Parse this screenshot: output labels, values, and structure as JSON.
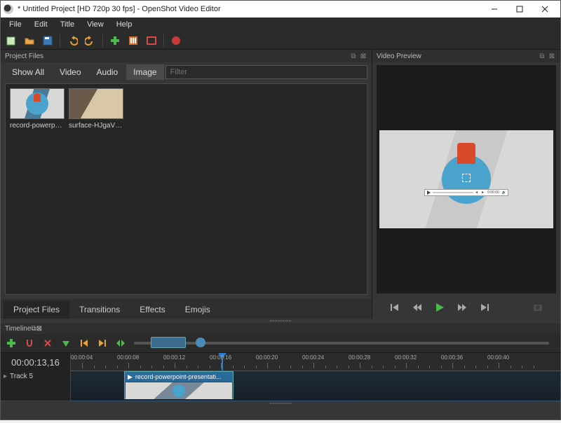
{
  "window": {
    "title": "* Untitled Project [HD 720p 30 fps] - OpenShot Video Editor"
  },
  "menubar": [
    "File",
    "Edit",
    "Title",
    "View",
    "Help"
  ],
  "panes": {
    "project_files": "Project Files",
    "video_preview": "Video Preview",
    "timeline": "Timeline"
  },
  "filter_tabs": [
    "Show All",
    "Video",
    "Audio",
    "Image"
  ],
  "filter_active_index": 3,
  "filter_placeholder": "Filter",
  "files": [
    {
      "name": "record-powerpo..."
    },
    {
      "name": "surface-HJgaV1..."
    }
  ],
  "bottom_tabs": [
    "Project Files",
    "Transitions",
    "Effects",
    "Emojis"
  ],
  "bottom_active_index": 0,
  "timeline": {
    "current_time": "00:00:13,16",
    "ruler_labels": [
      "00:00:04",
      "00:00:08",
      "00:00:12",
      "00:00:16",
      "00:00:20",
      "00:00:24",
      "00:00:28",
      "00:00:32",
      "00:00:36",
      "00:00:40"
    ],
    "track_name": "Track 5",
    "clip_name": "record-powerpoint-presentati..."
  }
}
